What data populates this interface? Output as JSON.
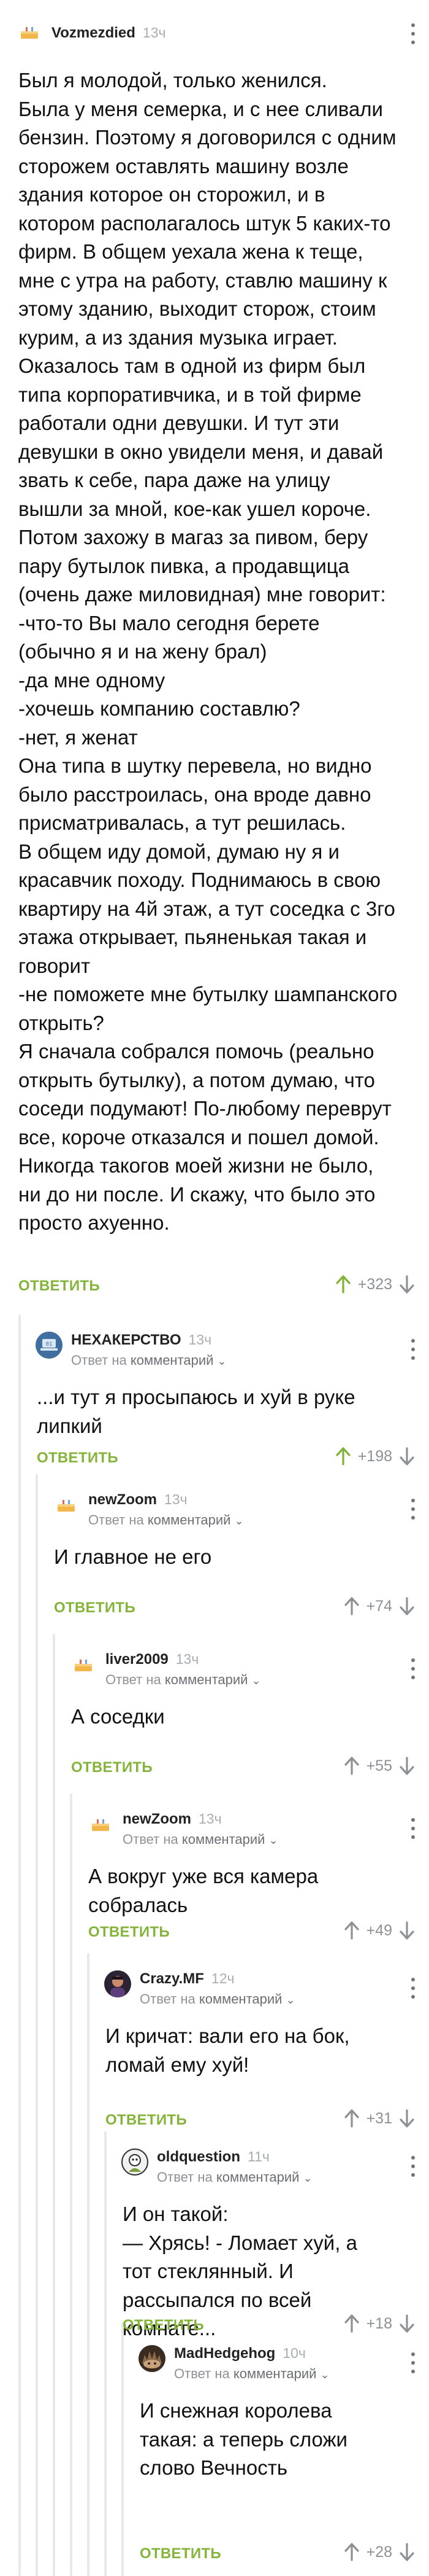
{
  "reply_label": "ОТВЕТИТЬ",
  "reply_to_text": "Ответ на",
  "reply_to_target": "комментарий",
  "comments": [
    {
      "author": "Vozmezdied",
      "time": "13ч",
      "avatar": "cake-avatar-icon",
      "body": "Был я молодой, только женился.\nБыла у меня семерка, и с нее сливали бензин. Поэтому я договорился с одним сторожем оставлять машину возле здания которое он сторожил, и в котором располагалось штук 5 каких-то фирм. В общем уехала жена к теще, мне с утра на работу, ставлю машину к этому зданию, выходит сторож, стоим курим, а из здания музыка играет. Оказалось там в одной из фирм был типа корпоративчика, и в той фирме работали одни девушки. И тут эти девушки в окно увидели меня, и давай звать к себе, пара даже на улицу вышли за мной, кое-как ушел короче. Потом захожу в магаз за пивом, беру пару бутылок пивка, а продавщица (очень даже миловидная) мне говорит:\n-что-то Вы мало сегодня берете (обычно я и на жену брал)\n-да мне одному\n-хочешь компанию составлю?\n-нет, я женат\nОна типа в шутку перевела, но видно было расстроилась, она вроде давно присматривалась, а тут решилась.\nВ общем иду домой, думаю ну я и красавчик походу. Поднимаюсь в свою квартиру на 4й этаж, а тут соседка с 3го этажа открывает, пьяненькая такая и говорит\n-не поможете мне бутылку шампанского открыть?\nЯ сначала собрался помочь (реально открыть бутылку), а потом думаю, что соседи подумают! По-любому переврут все, короче отказался и пошел домой.\nНикогда такогов моей жизни не было, ни до ни после. И скажу, что было это просто ахуенно.",
      "score": "+323",
      "is_reply": false
    },
    {
      "author": "НЕХАКЕРСТВО",
      "time": "13ч",
      "avatar": "hacker-avatar-icon",
      "body": "...и тут я просыпаюсь и хуй в руке липкий",
      "score": "+198",
      "is_reply": true
    },
    {
      "author": "newZoom",
      "time": "13ч",
      "avatar": "cake-avatar-icon",
      "body": "И главное не его",
      "score": "+74",
      "is_reply": true
    },
    {
      "author": "liver2009",
      "time": "13ч",
      "avatar": "cake-avatar-icon",
      "body": "А соседки",
      "score": "+55",
      "is_reply": true
    },
    {
      "author": "newZoom",
      "time": "13ч",
      "avatar": "cake-avatar-icon",
      "body": "А вокруг уже вся камера собралась",
      "score": "+49",
      "is_reply": true
    },
    {
      "author": "Crazy.MF",
      "time": "12ч",
      "avatar": "photo-avatar-icon",
      "body": "И кричат: вали его на бок, ломай ему хуй!",
      "score": "+31",
      "is_reply": true
    },
    {
      "author": "oldquestion",
      "time": "11ч",
      "avatar": "cartoon-avatar-icon",
      "body": "И он такой:\n— Хрясь! - Ломает хуй, а тот стеклянный. И рассыпался по всей комнате...",
      "score": "+18",
      "is_reply": true
    },
    {
      "author": "MadHedgehog",
      "time": "10ч",
      "avatar": "hedgehog-avatar-icon",
      "body": "И снежная королева такая: а теперь сложи слово Вечность",
      "score": "+28",
      "is_reply": true
    }
  ],
  "colors": {
    "reply_green": "#84b53a",
    "upvote_green": "#7fb236",
    "rail_gray": "#e6e8ea",
    "meta_gray": "#a9adb2"
  }
}
